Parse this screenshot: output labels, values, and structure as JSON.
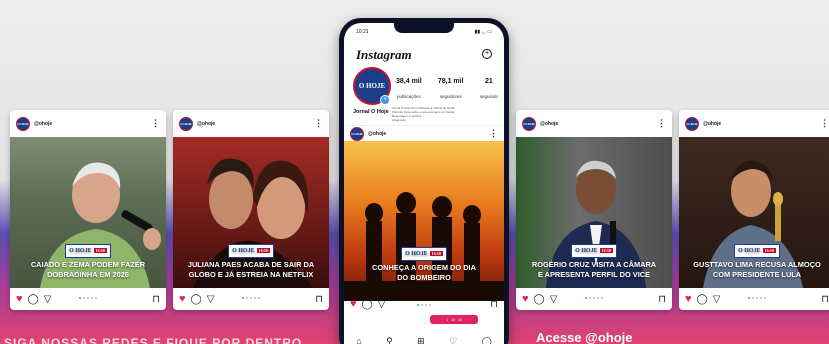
{
  "brand": {
    "handle": "@ohoje",
    "profile_name": "Jornal O Hoje",
    "logo_text": "O HOJE",
    "tag_sub": "16:50"
  },
  "phone": {
    "app_title": "Instagram",
    "time": "10:21",
    "stats": [
      {
        "value": "38,4 mil",
        "label": "publicações"
      },
      {
        "value": "78,1 mil",
        "label": "seguidores"
      },
      {
        "value": "21",
        "label": "seguindo"
      }
    ],
    "bio_lines": [
      "Jornal O Hoje ficou brilhante a notícia de Goiás",
      "Primeira fonte sobre o que acontece em Goiás",
      "Reportagem e política",
      "ohoje.com"
    ],
    "post_caption_1": "CONHEÇA A ORIGEM DO DIA",
    "post_caption_2": "DO BOMBEIRO",
    "notif": [
      "1",
      "23",
      "10"
    ]
  },
  "cards": [
    {
      "caption_1": "CAIADO E ZEMA PODEM FAZER",
      "caption_2": "DOBRADINHA EM 2026"
    },
    {
      "caption_1": "JULIANA PAES ACABA DE SAIR DA",
      "caption_2": "GLOBO E JÁ ESTREIA NA NETFLIX"
    },
    {
      "caption_1": "ROGÉRIO CRUZ VISITA A CÂMARA",
      "caption_2": "E APRESENTA PERFIL DO VICE"
    },
    {
      "caption_1": "GUSTTAVO LIMA RECUSA ALMOÇO",
      "caption_2": "COM PRESIDENTE LULA"
    }
  ],
  "footer": {
    "cta": "Acesse @ohoje",
    "left_text": "SIGA NOSSAS REDES E FIQUE POR DENTRO"
  },
  "colors": {
    "brand_blue": "#1c3e8a",
    "brand_red": "#c8102e",
    "like": "#e0245e"
  }
}
